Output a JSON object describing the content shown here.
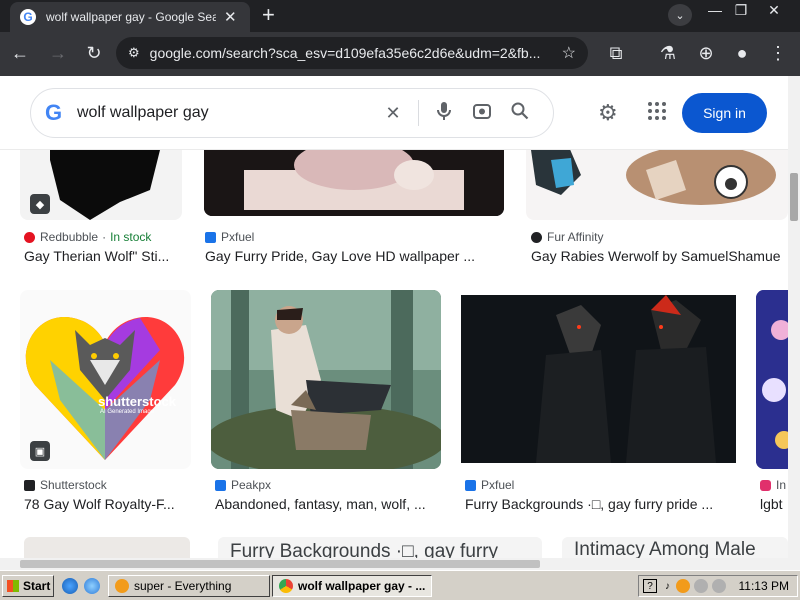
{
  "browser": {
    "tab_title": "wolf wallpaper gay - Google Search",
    "tab_favicon": "G",
    "new_tab_symbol": "+",
    "close_tab_symbol": "✕",
    "url": "google.com/search?sca_esv=d109efa35e6c2d6e&udm=2&fb...",
    "window_controls": [
      "—",
      "❐",
      "✕"
    ]
  },
  "google": {
    "logo_letter": "G",
    "query": "wolf wallpaper gay",
    "signin_label": "Sign in"
  },
  "results": {
    "row1": [
      {
        "source": "Redbubble",
        "stock": "In stock",
        "title": "Gay Therian Wolf\" Sti...",
        "fav_color": "#e41321"
      },
      {
        "source": "Pxfuel",
        "title": "Gay Furry Pride, Gay Love HD wallpaper ...",
        "fav_color": "#1a73e8"
      },
      {
        "source": "Fur Affinity",
        "title": "Gay Rabies Werwolf by SamuelShamue",
        "fav_color": "#202124"
      }
    ],
    "row2": [
      {
        "source": "Shutterstock",
        "title": "78 Gay Wolf Royalty-F...",
        "fav_color": "#202124"
      },
      {
        "source": "Peakpx",
        "title": "Abandoned, fantasy, man, wolf, ...",
        "fav_color": "#1a73e8"
      },
      {
        "source": "Pxfuel",
        "title": "Furry Backgrounds ·□, gay furry pride ...",
        "fav_color": "#1a73e8"
      },
      {
        "source": "In",
        "title": "lgbt",
        "fav_color": "#e1306c"
      }
    ],
    "row3_alt": [
      "Furry Backgrounds ·□, gay furry",
      "Intimacy Among Male"
    ],
    "shutterstock_watermark": "shutterstock",
    "shutterstock_sub": "AI Generated Image"
  },
  "taskbar": {
    "start_label": "Start",
    "tasks": [
      {
        "label": "super - Everything",
        "active": false
      },
      {
        "label": "wolf wallpaper gay - ...",
        "active": true
      }
    ],
    "help_symbol": "?",
    "clock": "11:13 PM"
  }
}
